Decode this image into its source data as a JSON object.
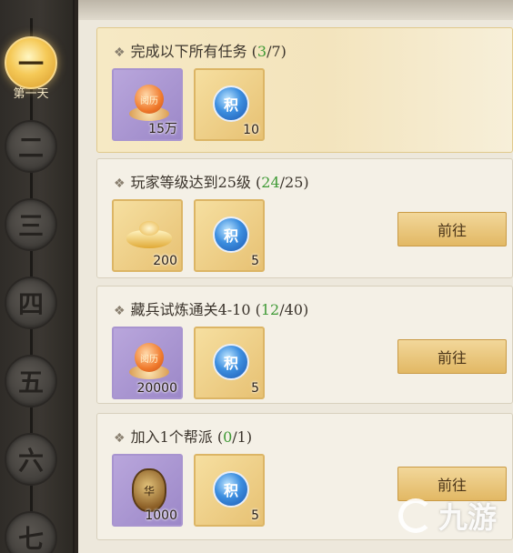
{
  "days": [
    {
      "label": "一",
      "active": true
    },
    {
      "label": "二",
      "active": false
    },
    {
      "label": "三",
      "active": false
    },
    {
      "label": "四",
      "active": false
    },
    {
      "label": "五",
      "active": false
    },
    {
      "label": "六",
      "active": false
    },
    {
      "label": "七",
      "active": false
    }
  ],
  "active_day_caption": "第一天",
  "tasks": [
    {
      "title": "完成以下所有任务",
      "progress_current": "3",
      "progress_total": "7",
      "rewards": [
        {
          "icon": "exp-scroll-icon",
          "icon_text": "阅历",
          "qty": "15万"
        },
        {
          "icon": "points-orb-icon",
          "icon_text": "积",
          "qty": "10"
        }
      ],
      "button": ""
    },
    {
      "title": "玩家等级达到25级",
      "progress_current": "24",
      "progress_total": "25",
      "rewards": [
        {
          "icon": "gold-ingot-icon",
          "icon_text": "",
          "qty": "200"
        },
        {
          "icon": "points-orb-icon",
          "icon_text": "积",
          "qty": "5"
        }
      ],
      "button": "前往"
    },
    {
      "title": "藏兵试炼通关4-10",
      "progress_current": "12",
      "progress_total": "40",
      "rewards": [
        {
          "icon": "exp-scroll-icon",
          "icon_text": "阅历",
          "qty": "20000"
        },
        {
          "icon": "points-orb-icon",
          "icon_text": "积",
          "qty": "5"
        }
      ],
      "button": "前往"
    },
    {
      "title": "加入1个帮派",
      "progress_current": "0",
      "progress_total": "1",
      "rewards": [
        {
          "icon": "coin-pouch-icon",
          "icon_text": "华",
          "qty": "1000"
        },
        {
          "icon": "points-orb-icon",
          "icon_text": "积",
          "qty": "5"
        }
      ],
      "button": "前往"
    }
  ],
  "watermark": "九游",
  "colors": {
    "progress_current": "#3f9a36",
    "button_bg": "#e2b864",
    "active_day": "#f5c957"
  }
}
